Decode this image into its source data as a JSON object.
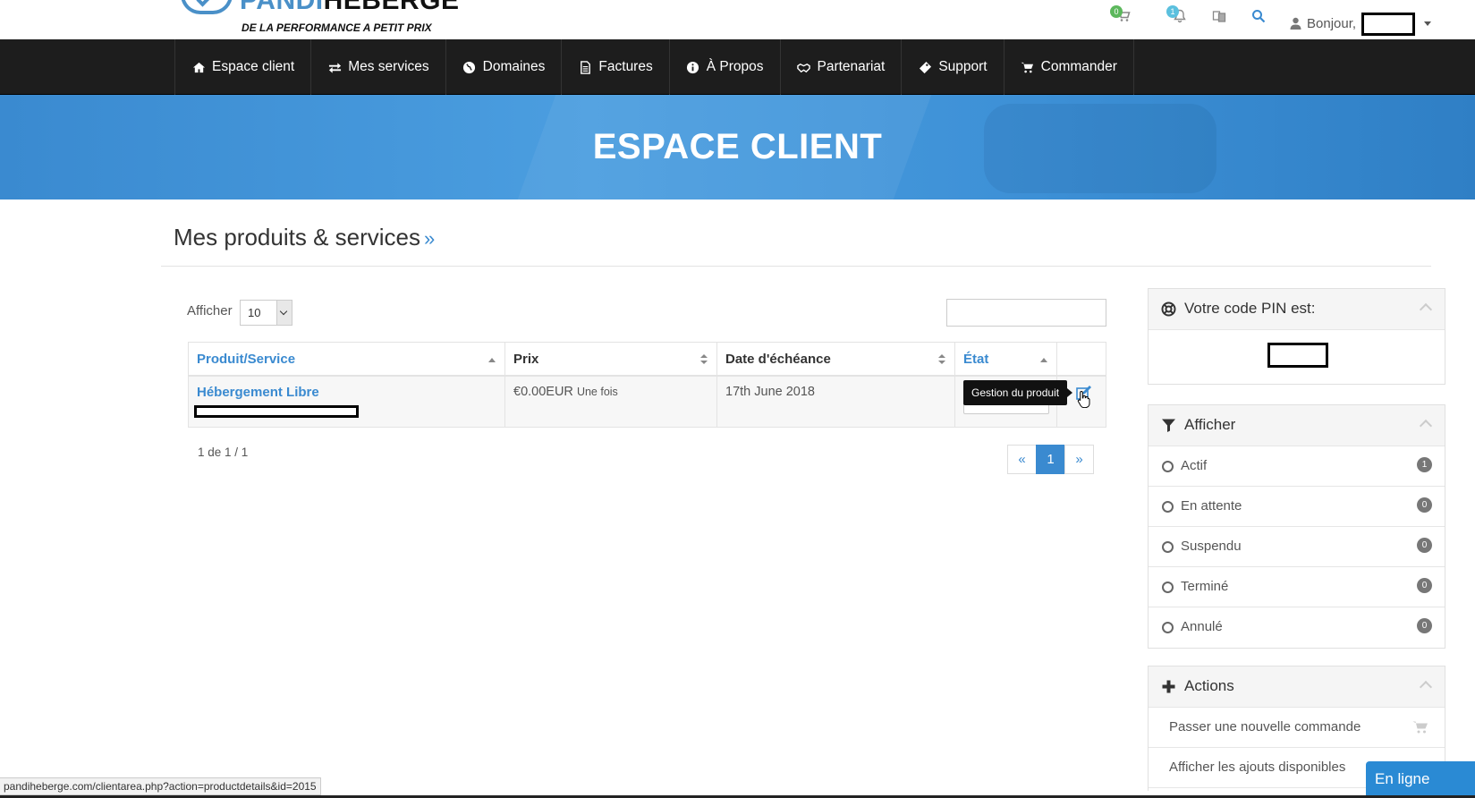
{
  "header": {
    "logo_name_blue": "PANDI",
    "logo_name_dark": "HEBERGE",
    "logo_tagline": "DE LA PERFORMANCE A PETIT PRIX",
    "cart_count": "0",
    "notif_count": "1",
    "greeting": "Bonjour,"
  },
  "nav": {
    "items": [
      {
        "label": "Espace client",
        "icon": "home-icon"
      },
      {
        "label": "Mes services",
        "icon": "exchange-icon"
      },
      {
        "label": "Domaines",
        "icon": "globe-icon"
      },
      {
        "label": "Factures",
        "icon": "file-icon"
      },
      {
        "label": "À Propos",
        "icon": "info-icon"
      },
      {
        "label": "Partenariat",
        "icon": "handshake-icon"
      },
      {
        "label": "Support",
        "icon": "ticket-icon"
      },
      {
        "label": "Commander",
        "icon": "cart-icon"
      }
    ]
  },
  "banner": {
    "title": "ESPACE CLIENT"
  },
  "main": {
    "page_title": "Mes produits & services",
    "title_suffix": "»",
    "afficher_label": "Afficher",
    "page_size": "10",
    "columns": [
      "Produit/Service",
      "Prix",
      "Date d'échéance",
      "État"
    ],
    "rows": [
      {
        "product": "Hébergement Libre",
        "price": "€0.00EUR",
        "price_cycle": "Une fois",
        "due_date": "17th June 2018"
      }
    ],
    "tooltip": "Gestion du produit",
    "pager_info": "1 de 1 / 1",
    "pager": {
      "prev": "«",
      "current": "1",
      "next": "»"
    }
  },
  "sidebar": {
    "pin_title": "Votre code PIN est:",
    "filter_title": "Afficher",
    "filters": [
      {
        "label": "Actif",
        "count": "1"
      },
      {
        "label": "En attente",
        "count": "0"
      },
      {
        "label": "Suspendu",
        "count": "0"
      },
      {
        "label": "Terminé",
        "count": "0"
      },
      {
        "label": "Annulé",
        "count": "0"
      }
    ],
    "actions_title": "Actions",
    "actions": [
      {
        "label": "Passer une nouvelle commande"
      },
      {
        "label": "Afficher les ajouts disponibles"
      }
    ]
  },
  "statusbar": {
    "url": "pandiheberge.com/clientarea.php?action=productdetails&id=2015"
  },
  "chat": {
    "label": "En ligne"
  },
  "colors": {
    "accent": "#3a8ad0",
    "nav_bg": "#1d1d1d",
    "badge_green": "#5cb85c",
    "badge_blue": "#5bc0de"
  }
}
